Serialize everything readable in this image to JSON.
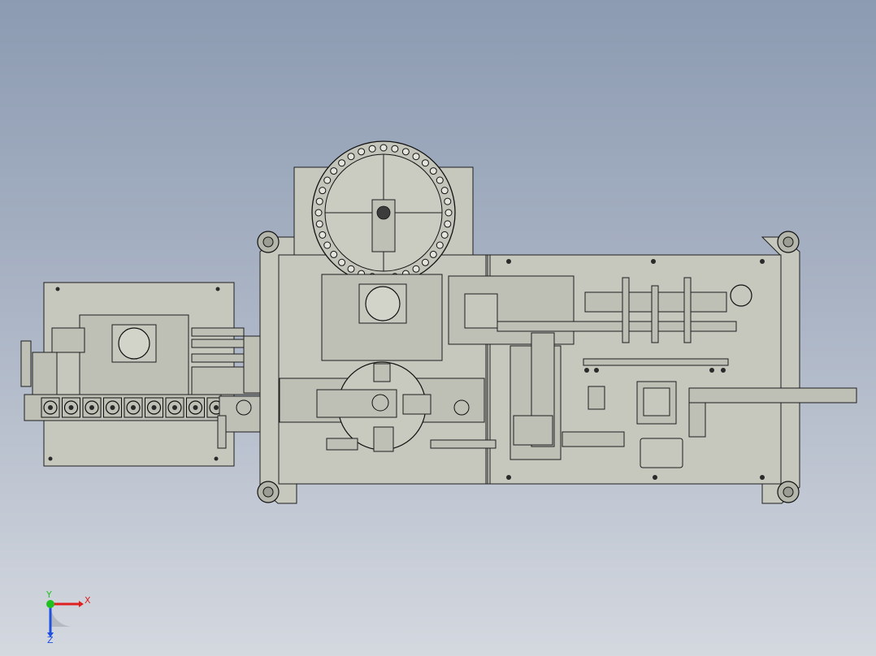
{
  "triad": {
    "x_label": "X",
    "y_label": "Y",
    "z_label": "Z",
    "x_color": "#e02020",
    "y_color": "#20c020",
    "z_color": "#2050e0"
  },
  "colors": {
    "background_top": "#8c9bb2",
    "background_bottom": "#d4d8df",
    "plate": "#c7c8bd",
    "edge": "#1e1e1e"
  }
}
